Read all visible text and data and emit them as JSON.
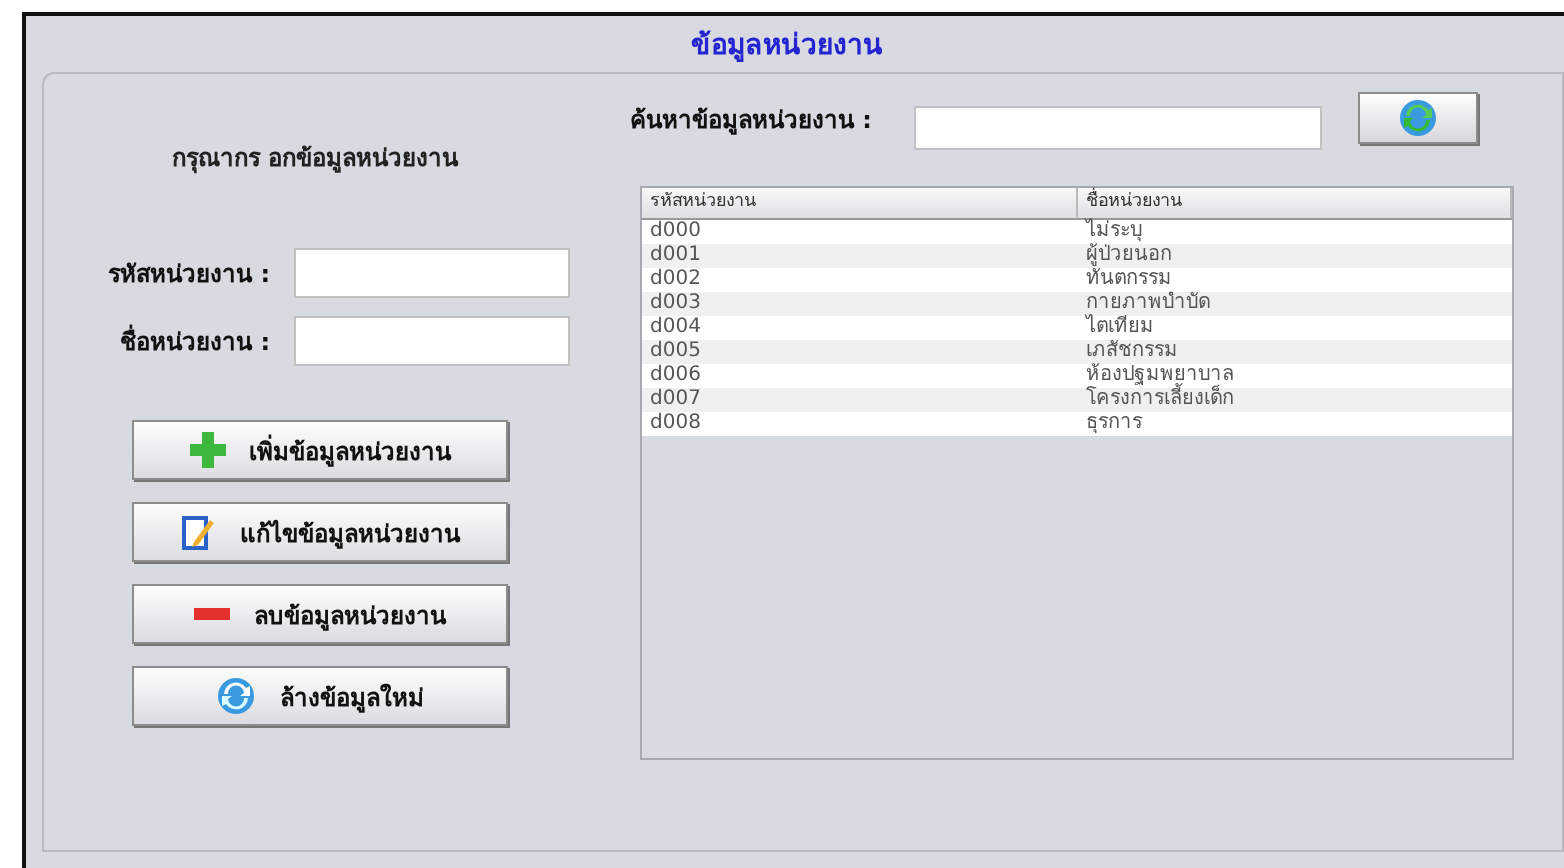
{
  "window": {
    "title": "ข้อมูลหน่วยงาน"
  },
  "form": {
    "heading": "กรุณากร อกข้อมูลหน่วยงาน",
    "fields": [
      {
        "label": "รหัสหน่วยงาน :"
      },
      {
        "label": "ชื่อหน่วยงาน :"
      }
    ],
    "buttons": [
      {
        "kind": "add",
        "label": "เพิ่มข้อมูลหน่วยงาน"
      },
      {
        "kind": "edit",
        "label": "แก้ไขข้อมูลหน่วยงาน"
      },
      {
        "kind": "delete",
        "label": "ลบข้อมูลหน่วยงาน"
      },
      {
        "kind": "clear",
        "label": "ล้างข้อมูลใหม่"
      }
    ]
  },
  "search": {
    "label": "ค้นหาข้อมูลหน่วยงาน :",
    "button": {
      "kind": "refresh"
    }
  },
  "table": {
    "columns": [
      "รหัสหน่วยงาน",
      "ชื่อหน่วยงาน"
    ],
    "rows": [
      [
        "d000",
        "ไม่ระบุ"
      ],
      [
        "d001",
        "ผู้ป่วยนอก"
      ],
      [
        "d002",
        "ทันตกรรม"
      ],
      [
        "d003",
        "กายภาพบำบัด"
      ],
      [
        "d004",
        "ไตเทียม"
      ],
      [
        "d005",
        "เภสัชกรรม"
      ],
      [
        "d006",
        "ห้องปฐมพยาบาล"
      ],
      [
        "d007",
        "โครงการเลี้ยงเด็ก"
      ],
      [
        "d008",
        "ธุรการ"
      ]
    ]
  }
}
